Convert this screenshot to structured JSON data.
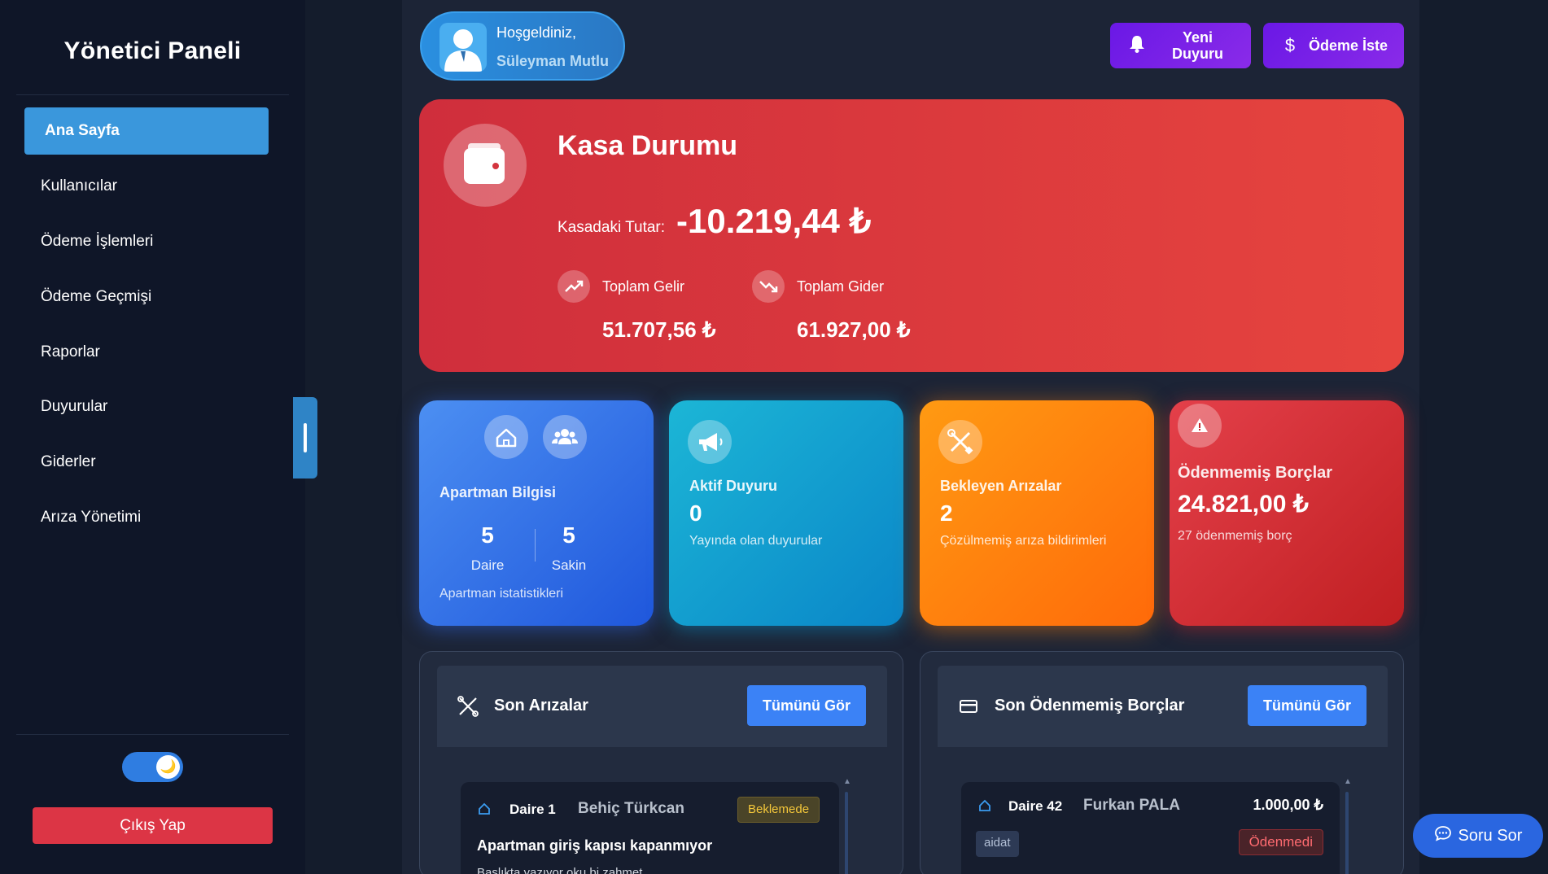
{
  "sidebar": {
    "title": "Yönetici Paneli",
    "items": [
      {
        "label": "Ana Sayfa"
      },
      {
        "label": "Kullanıcılar"
      },
      {
        "label": "Ödeme İşlemleri"
      },
      {
        "label": "Ödeme Geçmişi"
      },
      {
        "label": "Raporlar"
      },
      {
        "label": "Duyurular"
      },
      {
        "label": "Giderler"
      },
      {
        "label": "Arıza Yönetimi"
      }
    ],
    "theme_toggle_icon": "moon-icon",
    "logout_label": "Çıkış Yap"
  },
  "header": {
    "welcome": "Hoşgeldiniz,",
    "user_name": "Süleyman Mutlu",
    "announce_label_1": "Yeni",
    "announce_label_2": "Duyuru",
    "payment_label": "Ödeme İste"
  },
  "kasa": {
    "title": "Kasa Durumu",
    "amount_label": "Kasadaki Tutar:",
    "amount": "-10.219,44 ₺",
    "income_label": "Toplam Gelir",
    "income_value": "51.707,56 ₺",
    "expense_label": "Toplam Gider",
    "expense_value": "61.927,00 ₺"
  },
  "cards": {
    "apartment": {
      "title": "Apartman Bilgisi",
      "units_value": "5",
      "units_label": "Daire",
      "residents_value": "5",
      "residents_label": "Sakin",
      "desc": "Apartman istatistikleri"
    },
    "announcements": {
      "title": "Aktif Duyuru",
      "value": "0",
      "desc": "Yayında olan duyurular"
    },
    "faults": {
      "title": "Bekleyen Arızalar",
      "value": "2",
      "desc": "Çözülmemiş arıza bildirimleri"
    },
    "debts": {
      "title": "Ödenmemiş Borçlar",
      "value": "24.821,00 ₺",
      "desc": "27 ödenmemiş borç"
    }
  },
  "panels": {
    "faults": {
      "title": "Son Arızalar",
      "view_all": "Tümünü Gör",
      "item": {
        "unit": "Daire 1",
        "name": "Behiç Türkcan",
        "status": "Beklemede",
        "title": "Apartman giriş kapısı kapanmıyor",
        "desc": "Başlıkta yazıyor oku bi zahmet"
      }
    },
    "debts": {
      "title": "Son Ödenmemiş Borçlar",
      "view_all": "Tümünü Gör",
      "item": {
        "unit": "Daire 42",
        "name": "Furkan PALA",
        "amount": "1.000,00 ₺",
        "type": "aidat",
        "status": "Ödenmedi"
      }
    }
  },
  "help_button": "Soru Sor",
  "colors": {
    "accent": "#3a97dc",
    "danger": "#dc3545",
    "purple": "#7a20e8"
  }
}
